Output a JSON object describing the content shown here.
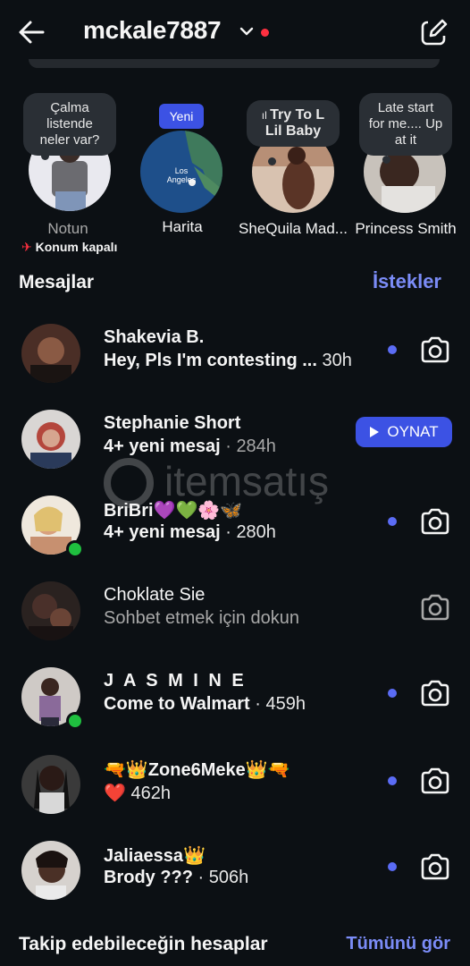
{
  "header": {
    "username": "mckale7887"
  },
  "notes": [
    {
      "bubble": "Çalma listende neler var?",
      "label": "Notun",
      "sublabel": "Konum kapalı"
    },
    {
      "badge": "Yeni",
      "map_text": "Los Angeles",
      "label": "Harita"
    },
    {
      "bubble": "Try To L Lil Baby",
      "label": "SheQuila Mad..."
    },
    {
      "bubble": "Late start for me.... Up at it",
      "label": "Princess Smith"
    }
  ],
  "messages_section": {
    "title": "Mesajlar",
    "requests_link": "İstekler"
  },
  "threads": [
    {
      "name": "Shakevia B.",
      "preview": "Hey, Pls I'm contesting ...",
      "time": "30h",
      "unread": true
    },
    {
      "name": "Stephanie Short",
      "preview": "4+ yeni mesaj",
      "time": "284h",
      "action": "OYNAT"
    },
    {
      "name": "BriBri💜💚🌸🦋",
      "preview": "4+ yeni mesaj",
      "time": "280h",
      "unread": true,
      "online": true
    },
    {
      "name": "Choklate Sie",
      "preview": "Sohbet etmek için dokun"
    },
    {
      "name": "J A S M I N E",
      "preview": "Come to Walmart",
      "time": "459h",
      "unread": true,
      "online": true
    },
    {
      "name": "🔫👑Zone6Meke👑🔫",
      "preview": "❤️",
      "time": "462h",
      "unread": true
    },
    {
      "name": "Jaliaessa👑",
      "preview": "Brody ???",
      "time": "506h",
      "unread": true
    }
  ],
  "watermark": "itemsatış",
  "suggestions": {
    "title": "Takip edebileceğin hesaplar",
    "see_all": "Tümünü gör"
  }
}
